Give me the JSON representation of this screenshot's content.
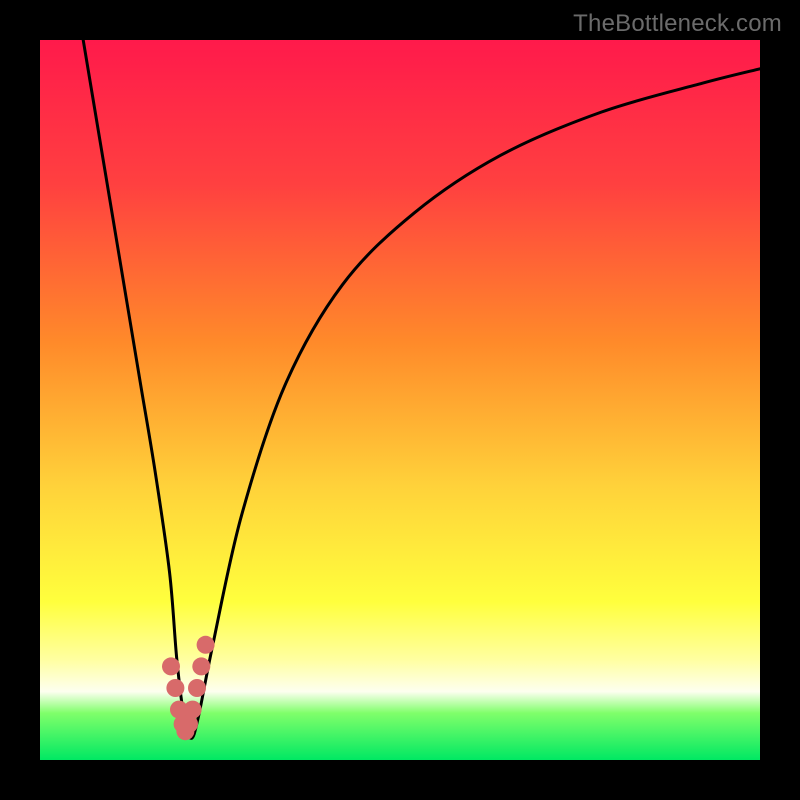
{
  "watermark": "TheBottleneck.com",
  "gradient": {
    "stops": [
      {
        "offset": 0,
        "color": "#ff1a4b"
      },
      {
        "offset": 0.2,
        "color": "#ff4040"
      },
      {
        "offset": 0.42,
        "color": "#ff8a2a"
      },
      {
        "offset": 0.62,
        "color": "#ffd23a"
      },
      {
        "offset": 0.78,
        "color": "#ffff3d"
      },
      {
        "offset": 0.86,
        "color": "#ffffa0"
      },
      {
        "offset": 0.905,
        "color": "#fdfff0"
      },
      {
        "offset": 0.935,
        "color": "#7fff6a"
      },
      {
        "offset": 1.0,
        "color": "#00e863"
      }
    ]
  },
  "curve": {
    "stroke": "#000000",
    "stroke_width": 3
  },
  "trough_marker": {
    "color": "#d86a6a",
    "radius": 9
  },
  "chart_data": {
    "type": "line",
    "title": "",
    "xlabel": "",
    "ylabel": "",
    "xlim": [
      0,
      100
    ],
    "ylim": [
      0,
      100
    ],
    "grid": false,
    "legend": false,
    "series": [
      {
        "name": "bottleneck-curve",
        "x": [
          6,
          8,
          10,
          12,
          14,
          16,
          18,
          19,
          20,
          21,
          22,
          24,
          28,
          34,
          42,
          52,
          64,
          78,
          92,
          100
        ],
        "y": [
          100,
          88,
          76,
          64,
          52,
          40,
          26,
          14,
          6,
          3,
          6,
          16,
          34,
          52,
          66,
          76,
          84,
          90,
          94,
          96
        ]
      }
    ],
    "annotations": [
      {
        "name": "trough-markers",
        "shape": "circle",
        "x": [
          18.2,
          18.8,
          19.3,
          19.8,
          20.2,
          20.7,
          21.2,
          21.8,
          22.4,
          23.0
        ],
        "y": [
          13.0,
          10.0,
          7.0,
          5.0,
          4.0,
          5.0,
          7.0,
          10.0,
          13.0,
          16.0
        ]
      }
    ]
  }
}
